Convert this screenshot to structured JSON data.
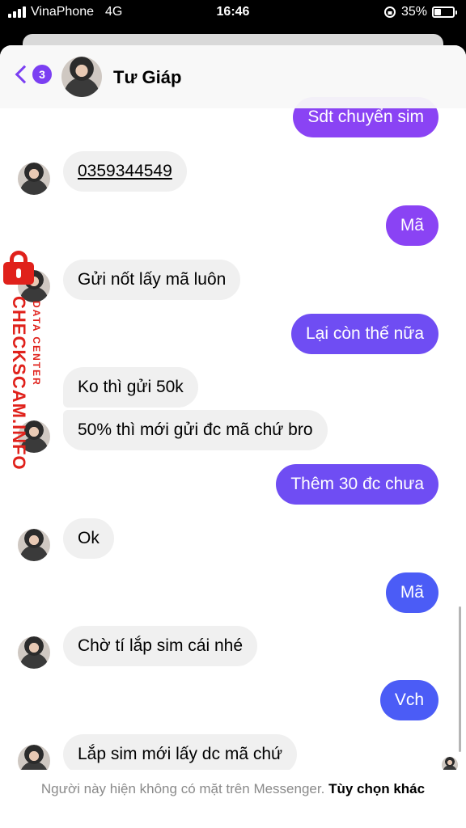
{
  "status": {
    "carrier": "VinaPhone",
    "network": "4G",
    "time": "16:46",
    "battery": "35%",
    "battery_level": 0.35
  },
  "header": {
    "back_count": "3",
    "contact_name": "Tư Giáp"
  },
  "watermark": {
    "brand": "CHECKSCAM.INFO",
    "sub": "DATA CENTER"
  },
  "colors": {
    "purple": "#8a43f4",
    "violet": "#6f4df3",
    "blue": "#4b5cf6",
    "incoming": "#f0f0f0"
  },
  "messages": [
    {
      "from": "me",
      "text": "Sdt chuyển sim"
    },
    {
      "from": "them",
      "text": "0359344549",
      "underline": true
    },
    {
      "from": "me",
      "text": "Mã"
    },
    {
      "from": "them",
      "text": "Gửi nốt lấy mã luôn"
    },
    {
      "from": "me",
      "text": "Lại còn thế nữa"
    },
    {
      "from": "them",
      "text": "Ko thì gửi 50k"
    },
    {
      "from": "them",
      "text": "50% thì mới gửi đc mã chứ bro"
    },
    {
      "from": "me",
      "text": "Thêm 30 đc chưa"
    },
    {
      "from": "them",
      "text": "Ok"
    },
    {
      "from": "me",
      "text": "Mã"
    },
    {
      "from": "them",
      "text": "Chờ tí lắp sim cái nhé"
    },
    {
      "from": "me",
      "text": "Vch"
    },
    {
      "from": "them",
      "text": "Lắp sim mới lấy dc mã chứ"
    }
  ],
  "footer": {
    "note": "Người này hiện không có mặt trên Messenger.",
    "link": "Tùy chọn khác"
  }
}
